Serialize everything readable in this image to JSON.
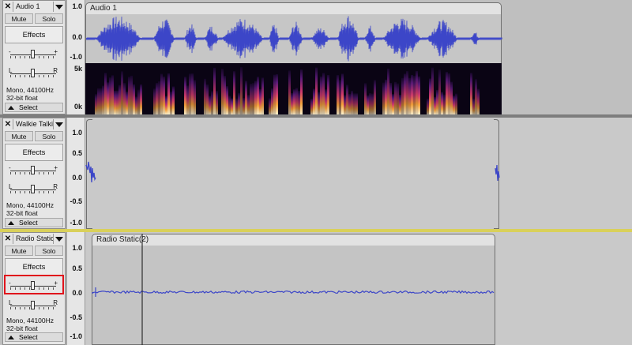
{
  "tracks": [
    {
      "name": "Audio 1",
      "mute_label": "Mute",
      "solo_label": "Solo",
      "effects_label": "Effects",
      "gain_minus": "-",
      "gain_plus": "+",
      "pan_left": "L",
      "pan_right": "R",
      "format_rate": "Mono, 44100Hz",
      "format_depth": "32-bit float",
      "select_label": "Select",
      "ruler": [
        "1.0",
        "0.0",
        "-1.0"
      ],
      "spectro_ruler": [
        "5k",
        "0k"
      ],
      "clip_title": "Audio 1"
    },
    {
      "name": "Walkie Talkie",
      "mute_label": "Mute",
      "solo_label": "Solo",
      "effects_label": "Effects",
      "gain_minus": "-",
      "gain_plus": "+",
      "pan_left": "L",
      "pan_right": "R",
      "format_rate": "Mono, 44100Hz",
      "format_depth": "32-bit float",
      "select_label": "Select",
      "ruler": [
        "1.0",
        "0.5",
        "0.0",
        "-0.5",
        "-1.0"
      ]
    },
    {
      "name": "Radio Static",
      "mute_label": "Mute",
      "solo_label": "Solo",
      "effects_label": "Effects",
      "gain_minus": "-",
      "gain_plus": "+",
      "pan_left": "L",
      "pan_right": "R",
      "format_rate": "Mono, 44100Hz",
      "format_depth": "32-bit float",
      "select_label": "Select",
      "ruler": [
        "1.0",
        "0.5",
        "0.0",
        "-0.5",
        "-1.0"
      ],
      "clip_title": "Radio Static(2)"
    }
  ],
  "colors": {
    "waveform": "#3c46c8",
    "highlight": "#e0141c"
  },
  "icons": {
    "close": "close-icon",
    "track_menu": "chevron-down-icon",
    "collapse": "collapse-icon"
  }
}
